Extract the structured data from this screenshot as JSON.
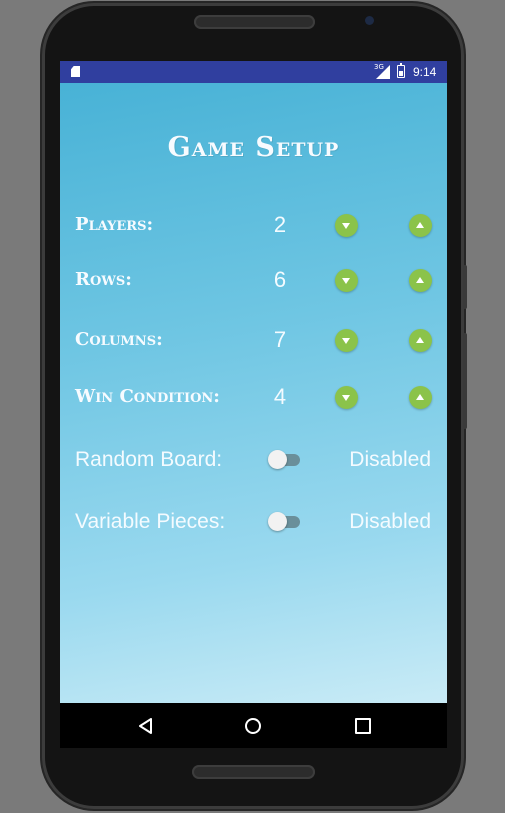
{
  "status_bar": {
    "time": "9:14",
    "network": "3G",
    "icons": [
      "sd-card-icon",
      "signal-icon",
      "battery-icon"
    ]
  },
  "title": "Game Setup",
  "settings": [
    {
      "label": "Players:",
      "value": "2"
    },
    {
      "label": "Rows:",
      "value": "6"
    },
    {
      "label": "Columns:",
      "value": "7"
    },
    {
      "label": "Win Condition:",
      "value": "4"
    }
  ],
  "toggles": [
    {
      "label": "Random Board:",
      "state": "Disabled",
      "on": false
    },
    {
      "label": "Variable Pieces:",
      "state": "Disabled",
      "on": false
    }
  ],
  "nav": {
    "icons": [
      "back-icon",
      "home-icon",
      "recents-icon"
    ]
  },
  "colors": {
    "status_bar": "#303f9f",
    "button": "#8bc34a",
    "background_top": "#48b2d6",
    "background_bottom": "#c9ebf6"
  }
}
